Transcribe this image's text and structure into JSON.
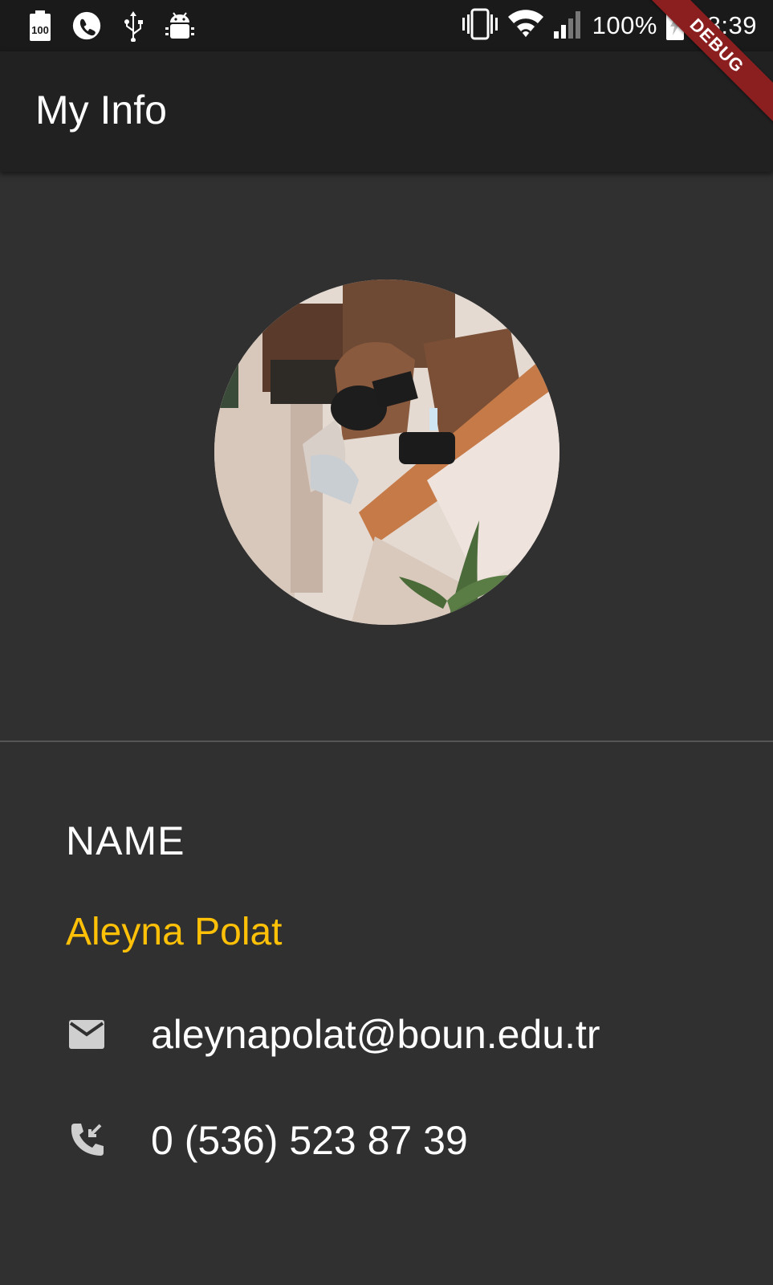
{
  "status_bar": {
    "icons_left": [
      "battery-100-badge-icon",
      "phone-call-icon",
      "usb-icon",
      "android-debug-icon"
    ],
    "battery_percent": "100%",
    "time": "18:39"
  },
  "app_bar": {
    "title": "My Info"
  },
  "debug_banner": "DEBUG",
  "profile": {
    "name_label": "NAME",
    "name": "Aleyna Polat",
    "email": "aleynapolat@boun.edu.tr",
    "phone": "0 (536) 523 87 39"
  },
  "colors": {
    "accent": "#ffc107",
    "background": "#303030",
    "app_bar": "#212121",
    "status_bar": "#1a1a1a",
    "icon_grey": "#cfcfcf"
  }
}
